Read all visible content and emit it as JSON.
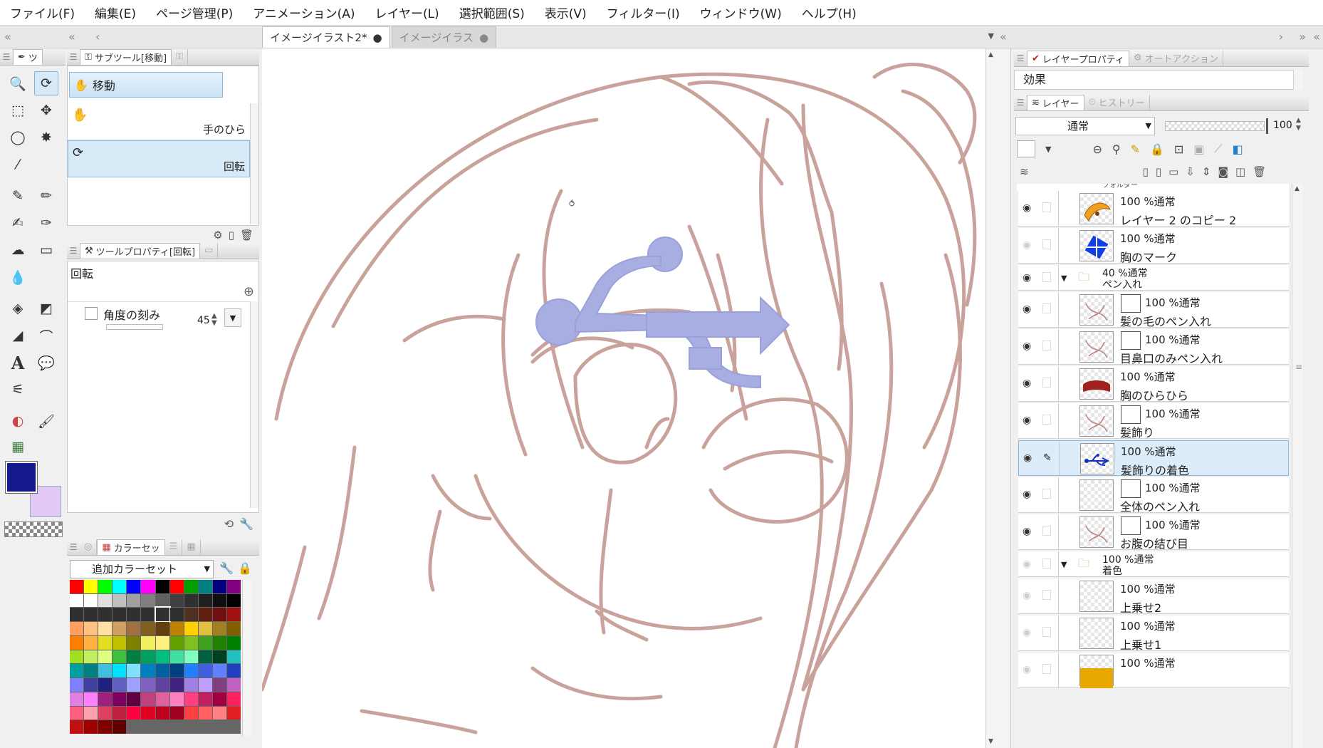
{
  "menu": [
    "ファイル(F)",
    "編集(E)",
    "ページ管理(P)",
    "アニメーション(A)",
    "レイヤー(L)",
    "選択範囲(S)",
    "表示(V)",
    "フィルター(I)",
    "ウィンドウ(W)",
    "ヘルプ(H)"
  ],
  "doc_tabs": [
    {
      "label": "イメージイラスト2*",
      "active": true
    },
    {
      "label": "イメージイラス",
      "active": false
    }
  ],
  "left": {
    "tool_tab": "ツ",
    "subtool_tab": "サブツール[移動]",
    "subtool_group": "移動",
    "subtools": [
      {
        "label": "手のひら",
        "selected": false
      },
      {
        "label": "回転",
        "selected": true
      }
    ],
    "toolprop_tab": "ツールプロパティ[回転]",
    "toolprop_title": "回転",
    "angle_label": "角度の刻み",
    "angle_value": "45",
    "color_tab": "カラーセッ",
    "color_set": "追加カラーセット",
    "main_color": "#141a8c",
    "sub_color": "#e2c8f4"
  },
  "right": {
    "top_tabs": [
      "レイヤープロパティ",
      "オートアクション"
    ],
    "effect_label": "効果",
    "mid_tabs": [
      "レイヤー",
      "ヒストリー"
    ],
    "blend_mode": "通常",
    "opacity": "100",
    "cut_label": "フォルダー",
    "layers": [
      {
        "mode": "100 %通常",
        "name": "レイヤー 2 のコピー 2",
        "thumb": "orange",
        "mask": false,
        "folder": false,
        "visible": true,
        "selected": false
      },
      {
        "mode": "100 %通常",
        "name": "胸のマーク",
        "thumb": "blue",
        "mask": false,
        "folder": false,
        "visible": false,
        "selected": false
      },
      {
        "mode": "40 %通常",
        "name": "ペン入れ",
        "folder": true,
        "visible": true
      },
      {
        "mode": "100 %通常",
        "name": "髪の毛のペン入れ",
        "thumb": "sketch",
        "mask": true,
        "folder": false,
        "visible": true,
        "selected": false
      },
      {
        "mode": "100 %通常",
        "name": "目鼻口のみペン入れ",
        "thumb": "sketch",
        "mask": true,
        "folder": false,
        "visible": true,
        "selected": false
      },
      {
        "mode": "100 %通常",
        "name": "胸のひらひら",
        "thumb": "red",
        "mask": false,
        "folder": false,
        "visible": true,
        "selected": false
      },
      {
        "mode": "100 %通常",
        "name": "髪飾り",
        "thumb": "sketch",
        "mask": true,
        "folder": false,
        "visible": true,
        "selected": false
      },
      {
        "mode": "100 %通常",
        "name": "髪飾りの着色",
        "thumb": "usb",
        "mask": false,
        "folder": false,
        "visible": true,
        "selected": true
      },
      {
        "mode": "100 %通常",
        "name": "全体のペン入れ",
        "thumb": "empty",
        "mask": true,
        "folder": false,
        "visible": true,
        "selected": false
      },
      {
        "mode": "100 %通常",
        "name": "お腹の結び目",
        "thumb": "sketch",
        "mask": true,
        "folder": false,
        "visible": true,
        "selected": false
      },
      {
        "mode": "100 %通常",
        "name": "着色",
        "folder": true,
        "visible": false
      },
      {
        "mode": "100 %通常",
        "name": "上乗せ2",
        "thumb": "empty",
        "mask": false,
        "folder": false,
        "visible": false,
        "selected": false
      },
      {
        "mode": "100 %通常",
        "name": "上乗せ1",
        "thumb": "empty",
        "mask": false,
        "folder": false,
        "visible": false,
        "selected": false
      },
      {
        "mode": "100 %通常",
        "name": "",
        "thumb": "yellow",
        "mask": false,
        "folder": false,
        "visible": false,
        "selected": false
      }
    ]
  },
  "palette": [
    "#ff0000",
    "#ffff00",
    "#00ff00",
    "#00ffff",
    "#0000ff",
    "#ff00ff",
    "#000000",
    "#ff0000",
    "#00a000",
    "#008080",
    "#000080",
    "#800080",
    "#ffffff",
    "#ffffff",
    "#e0e0e0",
    "#c0c0c0",
    "#a0a0a0",
    "#808080",
    "#606060",
    "#404040",
    "#303030",
    "#202020",
    "#101010",
    "#000000",
    "#303030",
    "#303030",
    "#303030",
    "#303030",
    "#303030",
    "#303030",
    "#303030",
    "#303030",
    "#503020",
    "#602010",
    "#701010",
    "#a01010",
    "#ffa060",
    "#ffc080",
    "#ffe0a0",
    "#d0a060",
    "#a07040",
    "#806020",
    "#604010",
    "#c08000",
    "#ffd000",
    "#e0c040",
    "#a08020",
    "#806000",
    "#ff8000",
    "#ffb040",
    "#e0e020",
    "#c0c000",
    "#808000",
    "#f0f060",
    "#fff080",
    "#60a000",
    "#80c020",
    "#40a020",
    "#208000",
    "#008000",
    "#a0e020",
    "#c0f060",
    "#e0ff80",
    "#40c040",
    "#008040",
    "#00a060",
    "#00c080",
    "#40e0a0",
    "#80ffc0",
    "#006040",
    "#004020",
    "#20c0c0",
    "#00a0a0",
    "#008080",
    "#40c0e0",
    "#00e0ff",
    "#80e0ff",
    "#0080c0",
    "#0060a0",
    "#004080",
    "#2080ff",
    "#4060e0",
    "#6080ff",
    "#2040c0",
    "#8080ff",
    "#4040a0",
    "#202080",
    "#6060c0",
    "#a0a0ff",
    "#8060c0",
    "#6040a0",
    "#402080",
    "#a080e0",
    "#c0a0ff",
    "#804080",
    "#c060c0",
    "#e080e0",
    "#ff80ff",
    "#a02080",
    "#800060",
    "#600040",
    "#c04080",
    "#e060a0",
    "#ff80c0",
    "#ff4080",
    "#c02060",
    "#a00040",
    "#ff2060",
    "#ff6080",
    "#ffa0b0",
    "#e04060",
    "#c02040",
    "#ff0040",
    "#e00020",
    "#c00020",
    "#a00020",
    "#ff4040",
    "#ff6060",
    "#ff8080",
    "#e02020",
    "#c01010",
    "#a00000",
    "#800000",
    "#600000"
  ]
}
